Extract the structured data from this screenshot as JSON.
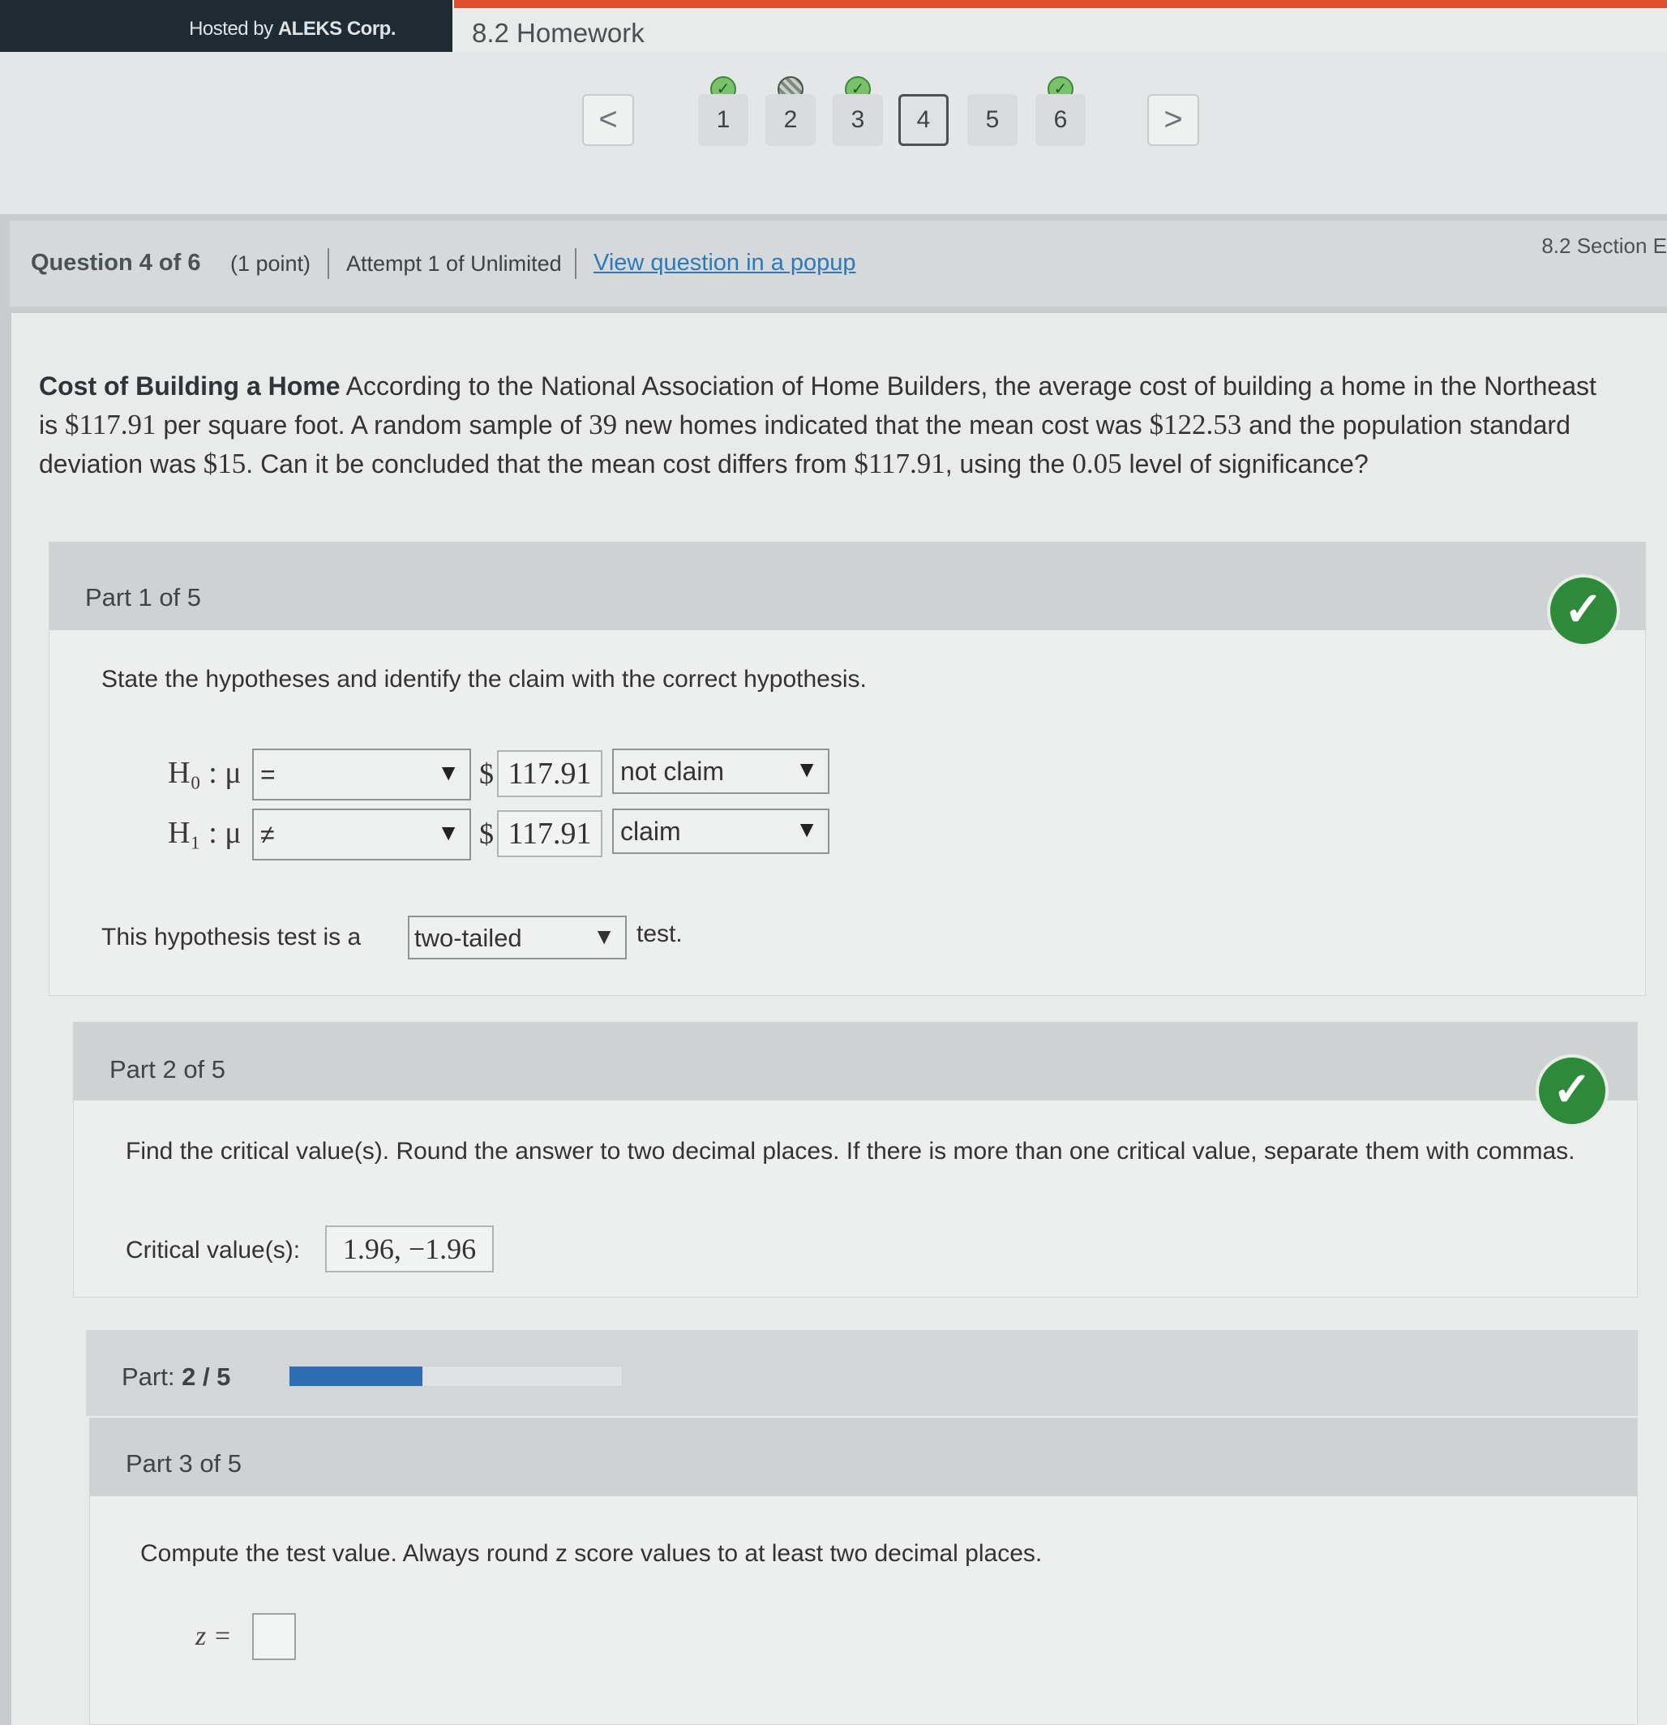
{
  "header": {
    "hosted_prefix": "Hosted by ",
    "hosted_brand": "ALEKS Corp.",
    "assignment_title": "8.2 Homework"
  },
  "navigator": {
    "prev_label": "<",
    "next_label": ">",
    "questions": [
      {
        "label": "1",
        "status": "correct"
      },
      {
        "label": "2",
        "status": "partial"
      },
      {
        "label": "3",
        "status": "correct"
      },
      {
        "label": "4",
        "status": "current"
      },
      {
        "label": "5",
        "status": "none"
      },
      {
        "label": "6",
        "status": "correct"
      }
    ]
  },
  "info": {
    "question": "Question 4 of 6",
    "points": "(1 point)",
    "attempt": "Attempt 1 of Unlimited",
    "popup_link": "View question in a popup",
    "section": "8.2 Section E"
  },
  "prompt": {
    "title": "Cost of Building a Home",
    "t1": " According to the National Association of Home Builders, the average cost of building a home in the Northeast is ",
    "v1": "$117.91",
    "t2": " per square foot. A random sample of ",
    "v2": "39",
    "t3": " new homes indicated that the mean cost was ",
    "v3": "$122.53",
    "t4": " and the population standard deviation was ",
    "v4": "$15",
    "t5": ". Can it be concluded that the mean cost differs from ",
    "v5": "$117.91",
    "t6": ", using the ",
    "v6": "0.05",
    "t7": " level of significance?"
  },
  "part1": {
    "header": "Part 1 of 5",
    "instruction": "State the hypotheses and identify the claim with the correct hypothesis.",
    "h0_label": "H₀ : μ",
    "h0_operator": "=",
    "h0_dollar": "$",
    "h0_value": "117.91",
    "h0_claim": "not claim",
    "h1_label": "H₁ : μ",
    "h1_operator": "≠",
    "h1_dollar": "$",
    "h1_value": "117.91",
    "h1_claim": "claim",
    "test_prefix": "This hypothesis test is a",
    "test_type": "two-tailed",
    "test_suffix": "test.",
    "status": "correct"
  },
  "part2": {
    "header": "Part 2 of 5",
    "instruction": "Find the critical value(s). Round the answer to two decimal places. If there is more than one critical value, separate them with commas.",
    "answer_label": "Critical value(s):",
    "answer_value": "1.96, −1.96",
    "status": "correct"
  },
  "progress": {
    "label": "Part:",
    "value": "2 / 5",
    "fraction": 0.4,
    "fill_color": "#2e6fb3"
  },
  "part3": {
    "header": "Part 3 of 5",
    "instruction": "Compute the test value. Always round z score values to at least two decimal places.",
    "z_label": "z =",
    "z_value": ""
  },
  "colors": {
    "accent": "#e0502e",
    "link": "#2d78b8",
    "correct": "#2e8a3a"
  }
}
